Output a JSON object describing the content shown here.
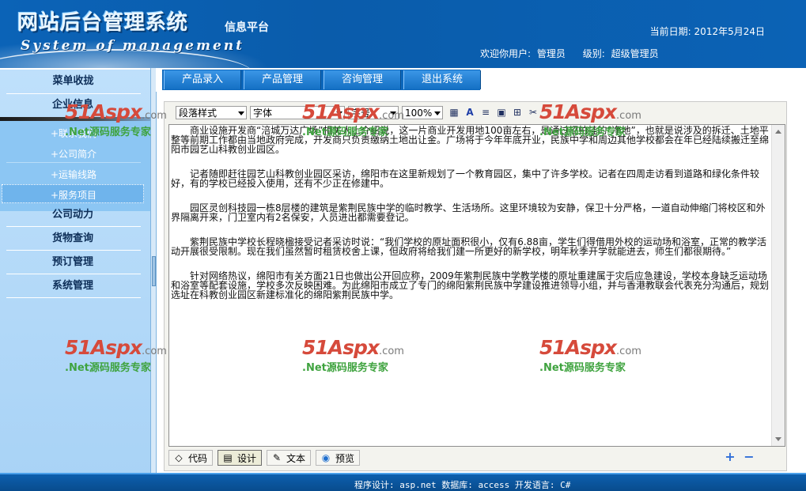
{
  "header": {
    "title": "网站后台管理系统",
    "subtitle": "System of management",
    "platform": "信息平台",
    "date_label": "当前日期:",
    "date_value": "2012年5月24日",
    "welcome_label": "欢迎你用户:",
    "user_name": "管理员",
    "level_label": "级别:",
    "level_value": "超级管理员"
  },
  "sidebar": {
    "menu_title": "菜单收拢",
    "group_company": "企业信息",
    "company_items": [
      "+联系我们",
      "+公司简介",
      "+运输线路",
      "+服务项目"
    ],
    "active_item_index": 3,
    "groups": [
      "公司动力",
      "货物查询",
      "预订管理",
      "系统管理"
    ]
  },
  "nav": {
    "tabs": [
      "产品录入",
      "产品管理",
      "咨询管理",
      "退出系统"
    ]
  },
  "editor": {
    "toolbar": {
      "paragraph_style": "段落样式",
      "font": "字体",
      "size": "字号",
      "zoom": "100%"
    },
    "content": [
      "商业设施开发商“涪城万达广场”相关人士介绍说，这一片商业开发用地100亩左右，是通过招拍挂的“净地”，也就是说涉及的拆迁、土地平整等前期工作都由当地政府完成，开发商只负责缴纳土地出让金。广场将于今年年底开业，民族中学和周边其他学校都会在年已经陆续搬迁至绵阳市园艺山科教创业园区。",
      "记者随即赶往园艺山科教创业园区采访，绵阳市在这里新规划了一个教育园区，集中了许多学校。记者在四周走访看到道路和绿化条件较好，有的学校已经投入使用，还有不少正在修建中。",
      "园区灵创科技园一栋8层楼的建筑是紫荆民族中学的临时教学、生活场所。这里环境较为安静，保卫十分严格，一道自动伸缩门将校区和外界隔离开来，门卫室内有2名保安，人员进出都需要登记。",
      "紫荆民族中学校长程晓楹接受记者采访时说：“我们学校的原址面积很小，仅有6.88亩，学生们得借用外校的运动场和浴室，正常的教学活动开展很受限制。现在我们虽然暂时租赁校舍上课，但政府将给我们建一所更好的新学校，明年秋季开学就能进去，师生们都很期待。”",
      "针对网络热议，绵阳市有关方面21日也做出公开回应称，2009年紫荆民族中学教学楼的原址重建属于灾后应急建设，学校本身缺乏运动场和浴室等配套设施，学校多次反映困难。为此绵阳市成立了专门的绵阳紫荆民族中学建设推进领导小组，并与香港教联会代表充分沟通后，规划选址在科教创业园区新建标准化的绵阳紫荆民族中学。"
    ],
    "modes": [
      "代码",
      "设计",
      "文本",
      "预览"
    ],
    "active_mode_index": 1
  },
  "footer": {
    "text": "程序设计: asp.net 数据库: access 开发语言: C#"
  },
  "watermark": {
    "brand": "51Aspx",
    "domain": ".com",
    "tagline": ".Net源码服务专家"
  },
  "colors": {
    "header_blue": "#0b63b7",
    "sidebar_light": "#bfe0fb",
    "tab_blue": "#1470c4",
    "watermark_red": "#d64a3b",
    "watermark_green": "#3fa33f"
  }
}
